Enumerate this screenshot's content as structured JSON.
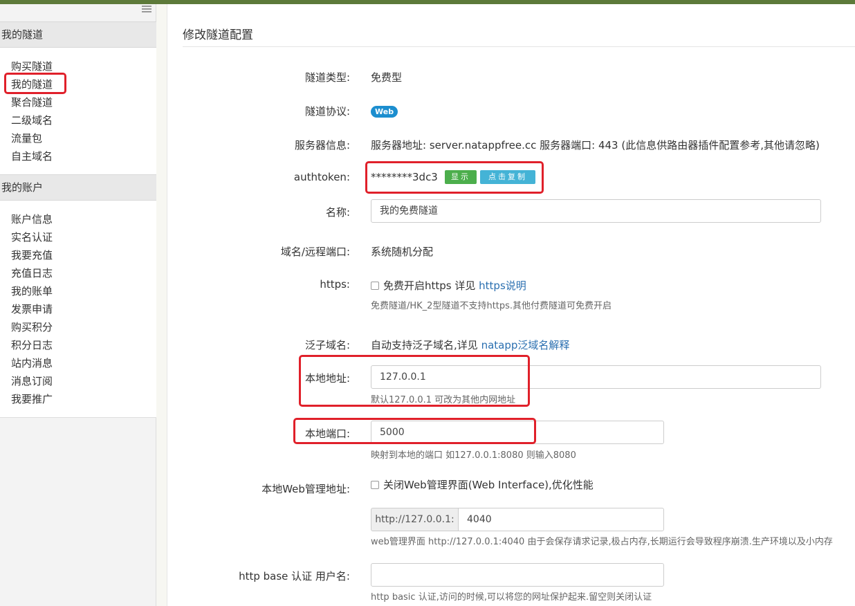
{
  "sidebar": {
    "tunnels_section": {
      "title": "我的隧道",
      "items": [
        "购买隧道",
        "我的隧道",
        "聚合隧道",
        "二级域名",
        "流量包",
        "自主域名"
      ]
    },
    "account_section": {
      "title": "我的账户",
      "items": [
        "账户信息",
        "实名认证",
        "我要充值",
        "充值日志",
        "我的账单",
        "发票申请",
        "购买积分",
        "积分日志",
        "站内消息",
        "消息订阅",
        "我要推广"
      ]
    }
  },
  "main": {
    "title": "修改隧道配置",
    "tunnel_type": {
      "label": "隧道类型:",
      "value": "免费型"
    },
    "protocol": {
      "label": "隧道协议:",
      "value": "Web"
    },
    "server_info": {
      "label": "服务器信息:",
      "value": "服务器地址: server.natappfree.cc 服务器端口: 443 (此信息供路由器插件配置参考,其他请忽略)"
    },
    "authtoken": {
      "label": "authtoken:",
      "value": "********3dc3",
      "show_button": "显示",
      "copy_button": "点击复制"
    },
    "name": {
      "label": "名称:",
      "value": "我的免费隧道"
    },
    "domain_port": {
      "label": "域名/远程端口:",
      "value": "系统随机分配"
    },
    "https": {
      "label": "https:",
      "checkbox_text": "免费开启https 详见",
      "link": "https说明",
      "help": "免费隧道/HK_2型隧道不支持https.其他付费隧道可免费开启"
    },
    "wildcard": {
      "label": "泛子域名:",
      "text": "自动支持泛子域名,详见",
      "link": "natapp泛域名解释"
    },
    "local_address": {
      "label": "本地地址:",
      "value": "127.0.0.1",
      "help": "默认127.0.0.1 可改为其他内网地址"
    },
    "local_port": {
      "label": "本地端口:",
      "value": "5000",
      "help": "映射到本地的端口 如127.0.0.1:8080 则输入8080"
    },
    "web_admin": {
      "label": "本地Web管理地址:",
      "checkbox_text": "关闭Web管理界面(Web Interface),优化性能",
      "prefix": "http://127.0.0.1:",
      "value": "4040",
      "help": "web管理界面 http://127.0.0.1:4040 由于会保存请求记录,极占内存,长期运行会导致程序崩溃.生产环境以及小内存"
    },
    "basic_auth": {
      "label": "http base 认证 用户名:",
      "value": "",
      "help": "http basic 认证,访问的时候,可以将您的网址保护起来.留空则关闭认证"
    }
  },
  "colors": {
    "accent_bar": "#5d7a3a",
    "link": "#2a6fb0",
    "highlight": "#e0202a",
    "badge": "#1c8ecf"
  }
}
